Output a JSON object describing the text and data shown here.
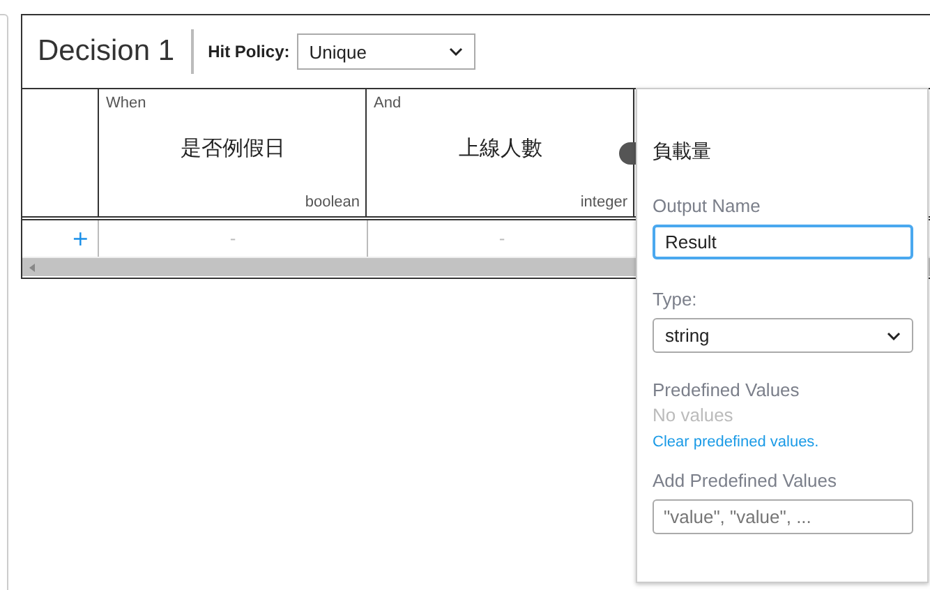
{
  "decision": {
    "title": "Decision 1",
    "hit_policy_label": "Hit Policy:",
    "hit_policy": "Unique"
  },
  "table": {
    "columns": [
      {
        "clause": "When",
        "name": "是否例假日",
        "type": "boolean"
      },
      {
        "clause": "And",
        "name": "上線人數",
        "type": "integer"
      }
    ],
    "rows": [
      {
        "add": "+",
        "cells": [
          "-",
          "-"
        ]
      }
    ]
  },
  "popover": {
    "title": "負載量",
    "output_name_label": "Output Name",
    "output_name": "Result",
    "type_label": "Type:",
    "type": "string",
    "predefined_label": "Predefined Values",
    "no_values": "No values",
    "clear_link": "Clear predefined values.",
    "add_label": "Add Predefined Values",
    "add_placeholder": "\"value\", \"value\", ..."
  }
}
